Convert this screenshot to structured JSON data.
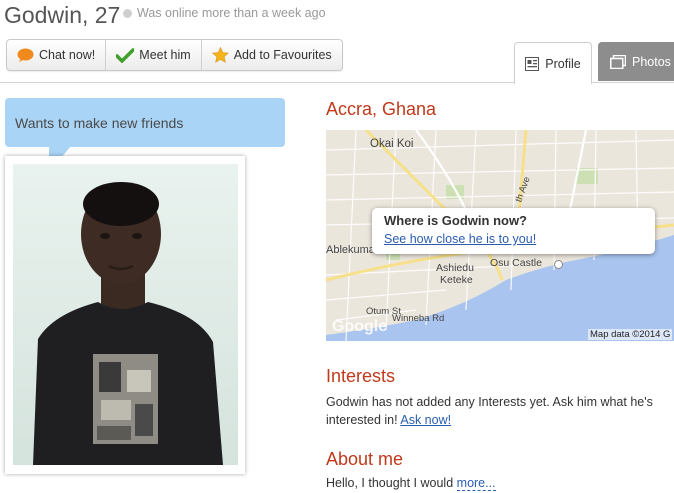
{
  "header": {
    "name_age": "Godwin, 27",
    "online_status": "Was online more than a week ago"
  },
  "actions": [
    {
      "label": "Chat now!",
      "icon": "chat-bubble-icon"
    },
    {
      "label": "Meet him",
      "icon": "checkmark-icon"
    },
    {
      "label": "Add to Favourites",
      "icon": "star-icon"
    }
  ],
  "tabs": {
    "profile": "Profile",
    "photos": "Photos"
  },
  "status_bubble": "Wants to make new friends",
  "location": {
    "city": "Accra, Ghana",
    "popup_title": "Where is Godwin now?",
    "popup_link": "See how close he is to you!",
    "map_labels": {
      "okai_koi": "Okai Koi",
      "ablekuma": "Ablekuma",
      "osu_castle": "Osu Castle",
      "ashiedu": "Ashiedu",
      "keteke": "Keteke",
      "otum_st": "Otum St",
      "winneba_rd": "Winneba Rd",
      "th_ave": "th Ave",
      "google": "Google",
      "map_data": "Map data ©2014 G"
    }
  },
  "interests": {
    "heading": "Interests",
    "text": "Godwin has not added any Interests yet. Ask him what he's interested in!",
    "link": "Ask now!"
  },
  "about": {
    "heading": "About me",
    "text": "Hello, I thought I would",
    "more": "more..."
  },
  "colors": {
    "heading": "#c0391b",
    "bubble": "#a9d4f5",
    "link": "#2a5db0",
    "photos_tab": "#8d8d8d"
  }
}
